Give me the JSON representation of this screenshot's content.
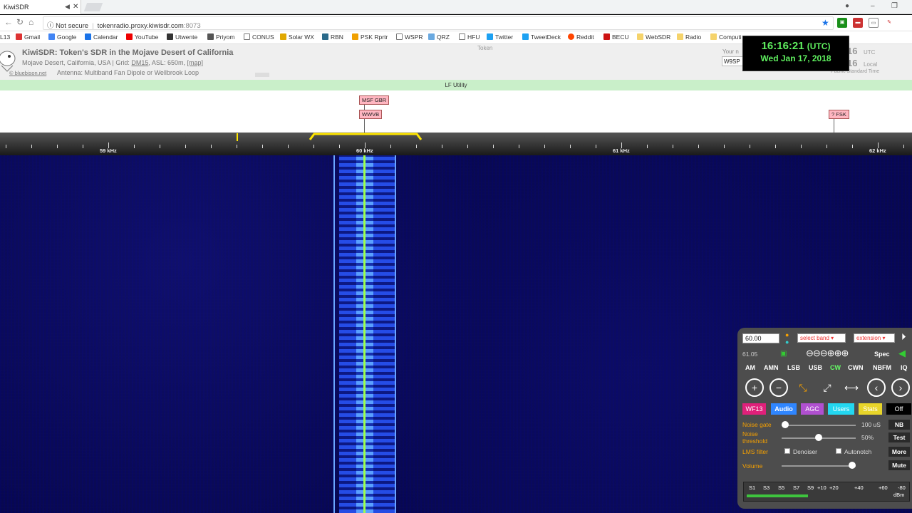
{
  "browser": {
    "tab_title": "KiwiSDR",
    "security": "Not secure",
    "url_host": "tokenradio.proxy.kiwisdr.com",
    "url_port": ":8073",
    "bookmarks": [
      "L13",
      "Gmail",
      "Google",
      "Calendar",
      "YouTube",
      "Utwente",
      "Priyom",
      "CONUS",
      "Solar WX",
      "RBN",
      "PSK Rprtr",
      "WSPR",
      "QRZ",
      "HFU",
      "Twitter",
      "TweetDeck",
      "Reddit",
      "BECU",
      "WebSDR",
      "Radio",
      "Computi"
    ]
  },
  "kiwi": {
    "title": "KiwiSDR: Token's SDR in the Mojave Desert of California",
    "location": "Mojave Desert, California, USA | Grid: ",
    "grid": "DM15",
    "asl": ", ASL: 650m, ",
    "map": "[map]",
    "antenna": "Antenna: Multiband Fan Dipole or Wellbrook Loop",
    "bluebison": "© bluebison.net",
    "token": "Token",
    "your_name": "Your n",
    "callsign": "W9SP",
    "clock_time": "16:16:21",
    "clock_utc": "(UTC)",
    "clock_date": "Wed Jan 17, 2018",
    "utc_frag": "16",
    "utc_label": "UTC",
    "local_frag": "16",
    "local_label": "Local",
    "tz_label": "Pacific Standard Time"
  },
  "band": {
    "name": "LF Utility"
  },
  "stations": [
    {
      "label": "MSF GBR"
    },
    {
      "label": "WWVB"
    },
    {
      "label": "? FSK"
    }
  ],
  "scale": {
    "labels": [
      "59 kHz",
      "60 kHz",
      "61 kHz",
      "62 kHz"
    ]
  },
  "panel": {
    "freq": "60.00",
    "select_band": "select band",
    "extension": "extension",
    "freq2": "61.05",
    "spec": "Spec",
    "modes": [
      "AM",
      "AMN",
      "LSB",
      "USB",
      "CW",
      "CWN",
      "NBFM",
      "IQ"
    ],
    "active_mode": "CW",
    "tabs": [
      "WF13",
      "Audio",
      "AGC",
      "Users",
      "Stats",
      "Off"
    ],
    "noise_gate_label": "Noise gate",
    "noise_gate_value": "100 uS",
    "nb": "NB",
    "noise_threshold_label": "Noise threshold",
    "noise_threshold_value": "50%",
    "test": "Test",
    "lms_label": "LMS filter",
    "denoiser": "Denoiser",
    "autonotch": "Autonotch",
    "more": "More",
    "volume_label": "Volume",
    "mute": "Mute",
    "smeter_labels": [
      "S1",
      "S3",
      "S5",
      "S7",
      "S9",
      "+10",
      "+20",
      "+40",
      "+60",
      "-80",
      "dBm"
    ],
    "noise_gate_level": 0.0,
    "noise_threshold_level": 0.5,
    "volume_level": 0.95
  },
  "colors": {
    "clock_green": "#5ff05f",
    "label_pink": "#ffb6c1",
    "band_green": "#c9efc9",
    "passband_yellow": "#ffe600",
    "cw_green": "#6f6",
    "wf13": "#e0207a",
    "audio": "#2f86ff",
    "agc": "#b050d0",
    "users": "#23d7f0",
    "stats": "#e8d52a"
  }
}
